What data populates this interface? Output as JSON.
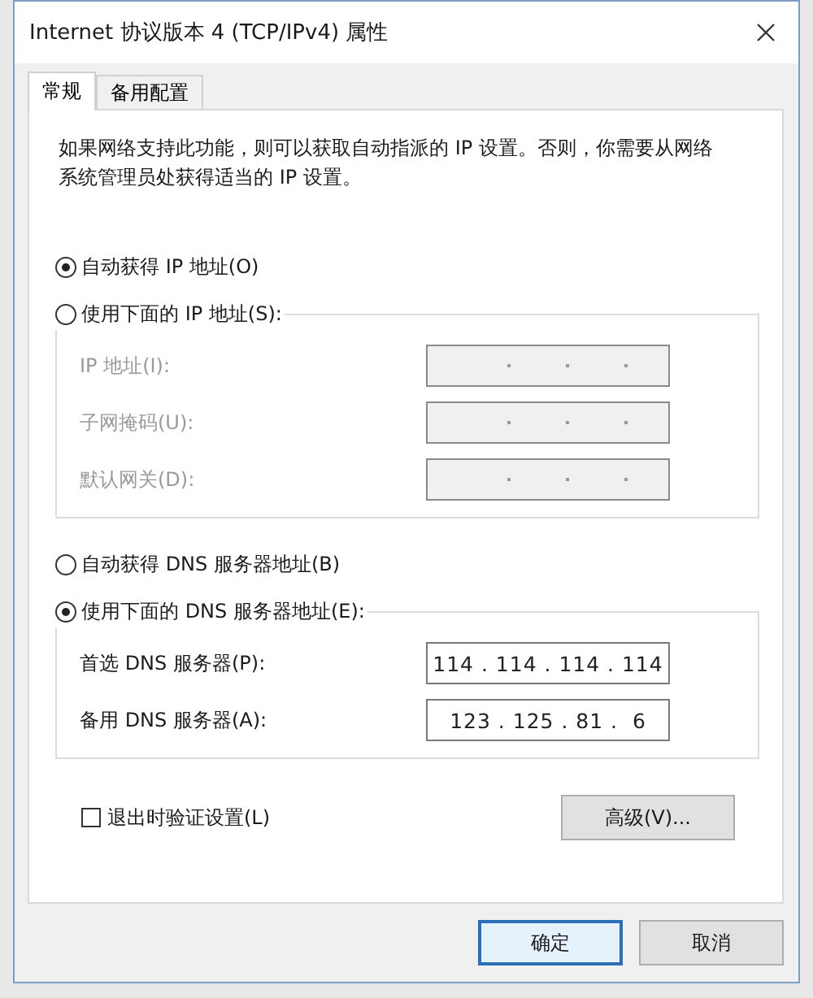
{
  "window": {
    "title": "Internet 协议版本 4 (TCP/IPv4) 属性"
  },
  "tabs": [
    {
      "label": "常规",
      "selected": true
    },
    {
      "label": "备用配置",
      "selected": false
    }
  ],
  "description": "如果网络支持此功能，则可以获取自动指派的 IP 设置。否则，你需要从网络系统管理员处获得适当的 IP 设置。",
  "ip_section": {
    "auto_option": {
      "label": "自动获得 IP 地址(O)",
      "selected": true
    },
    "manual_option": {
      "label": "使用下面的 IP 地址(S):",
      "selected": false
    },
    "fields": [
      {
        "label": "IP 地址(I):",
        "disabled": true
      },
      {
        "label": "子网掩码(U):",
        "disabled": true
      },
      {
        "label": "默认网关(D):",
        "disabled": true
      }
    ]
  },
  "dns_section": {
    "auto_option": {
      "label": "自动获得 DNS 服务器地址(B)",
      "selected": false
    },
    "manual_option": {
      "label": "使用下面的 DNS 服务器地址(E):",
      "selected": true
    },
    "fields": [
      {
        "label": "首选 DNS 服务器(P):",
        "value": "114 . 114 . 114 . 114",
        "disabled": false
      },
      {
        "label": "备用 DNS 服务器(A):",
        "value": "123 . 125 . 81 .  6",
        "disabled": false
      }
    ]
  },
  "validate_checkbox": {
    "label": "退出时验证设置(L)",
    "checked": false
  },
  "advanced_button": "高级(V)...",
  "buttons": [
    {
      "label": "确定",
      "default": true
    },
    {
      "label": "取消",
      "default": false
    }
  ]
}
